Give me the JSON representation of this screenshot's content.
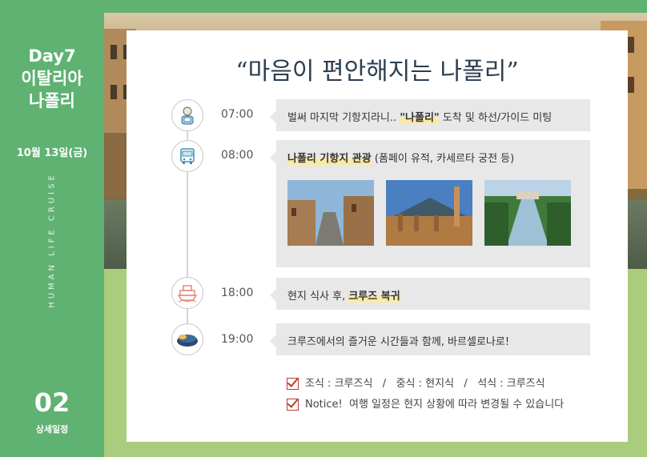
{
  "sidebar": {
    "day": "Day7",
    "country": "이탈리아",
    "city": "나폴리",
    "date": "10월 13일(금)",
    "brand": "HUMAN LIFE CRUISE",
    "page_number": "02",
    "section": "상세일정"
  },
  "headline": "“마음이 편안해지는 나폴리”",
  "schedule": [
    {
      "time": "07:00",
      "icon": "guide-person-icon",
      "pre": "벌써 마지막 기항지라니.. ",
      "highlight": "\"나폴리\"",
      "post": " 도착 및 하선/가이드 미팅"
    },
    {
      "time": "08:00",
      "icon": "bus-icon",
      "highlight": "나폴리 기항지 관광",
      "post": " (폼페이 유적, 카세르타 궁전 등)",
      "photos": [
        "pompeii-street-photo",
        "vesuvius-ruins-photo",
        "caserta-palace-gardens-photo"
      ]
    },
    {
      "time": "18:00",
      "icon": "ship-icon",
      "pre": "현지 식사 후, ",
      "highlight": "크루즈 복귀"
    },
    {
      "time": "19:00",
      "icon": "bed-icon",
      "pre": "크루즈에서의 즐거운 시간들과 함께, 바르셀로나로!"
    }
  ],
  "notes": [
    "조식 : 크루즈식   /   중식 : 현지식   /   석식 : 크루즈식",
    "Notice!  여행 일정은 현지 상황에 따라 변경될 수 있습니다"
  ],
  "colors": {
    "sidebar_green": "#5fb272",
    "highlight_yellow": "#fbe9a7",
    "box_gray": "#e8e8e8",
    "check_red": "#c0392b"
  }
}
